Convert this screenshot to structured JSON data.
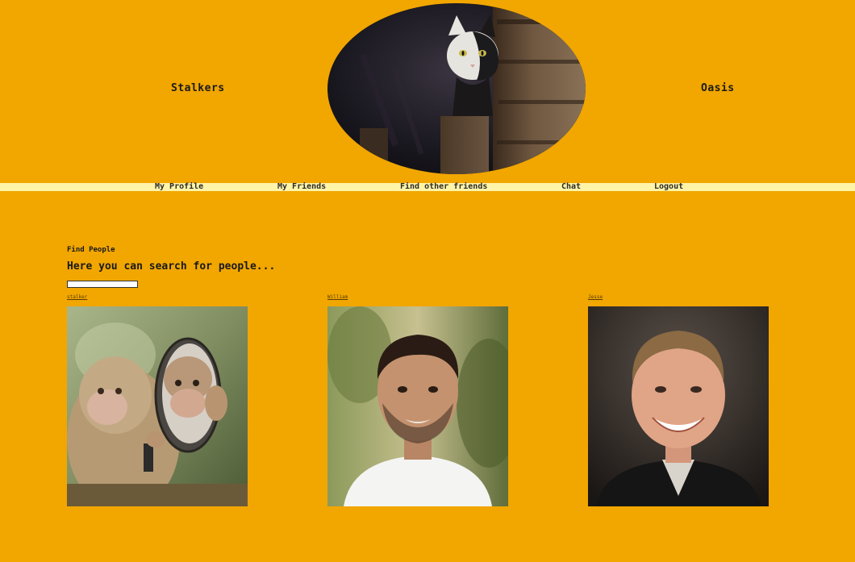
{
  "header": {
    "left_brand": "Stalkers",
    "right_brand": "Oasis",
    "banner_icon": "cat-photo"
  },
  "nav": {
    "items": [
      {
        "label": "My Profile"
      },
      {
        "label": "My Friends"
      },
      {
        "label": "Find other friends"
      },
      {
        "label": "Chat"
      },
      {
        "label": "Logout"
      }
    ]
  },
  "main": {
    "section_title": "Find People",
    "subtitle": "Here you can search for people...",
    "search_value": ""
  },
  "people": [
    {
      "name": "stalker",
      "photo_icon": "monkey-mirror-photo"
    },
    {
      "name": "William",
      "photo_icon": "man-portrait-photo"
    },
    {
      "name": "Jesse",
      "photo_icon": "man-smiling-photo"
    }
  ],
  "colors": {
    "background": "#f1a600",
    "navbar": "#fff4a8"
  }
}
